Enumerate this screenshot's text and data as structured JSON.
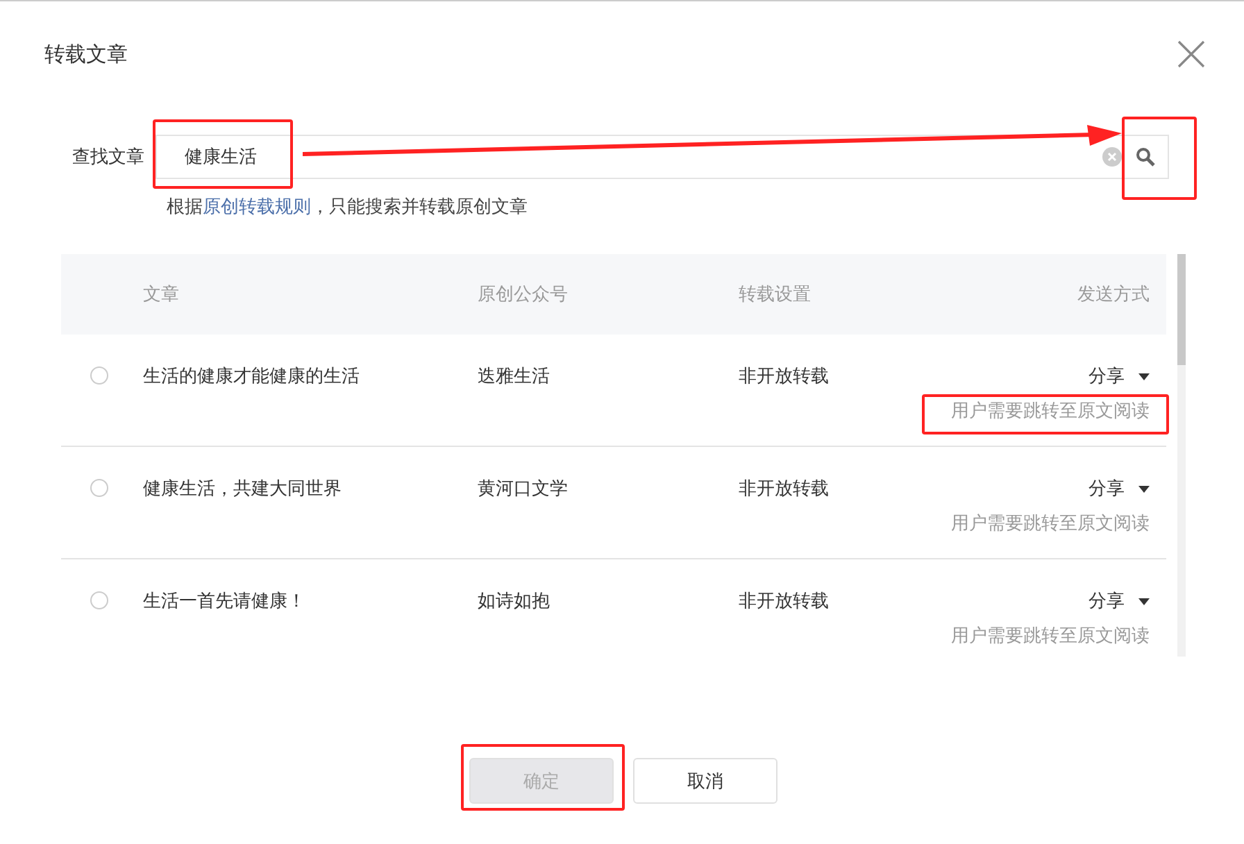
{
  "dialog": {
    "title": "转载文章"
  },
  "search": {
    "label": "查找文章",
    "value": "健康生活",
    "hint_before": "根据",
    "hint_link": "原创转载规则",
    "hint_after": "，只能搜索并转载原创文章"
  },
  "table": {
    "columns": [
      "文章",
      "原创公众号",
      "转载设置",
      "发送方式"
    ],
    "rows": [
      {
        "selected": false,
        "title": "生活的健康才能健康的生活",
        "account": "迭雅生活",
        "setting": "非开放转载",
        "send": "分享",
        "send_note": "用户需要跳转至原文阅读"
      },
      {
        "selected": false,
        "title": "健康生活，共建大同世界",
        "account": "黄河口文学",
        "setting": "非开放转载",
        "send": "分享",
        "send_note": "用户需要跳转至原文阅读"
      },
      {
        "selected": false,
        "title": "生活一首先请健康！",
        "account": "如诗如抱",
        "setting": "非开放转载",
        "send": "分享",
        "send_note": "用户需要跳转至原文阅读"
      }
    ]
  },
  "buttons": [
    {
      "label": "确定",
      "disabled": true
    },
    {
      "label": "取消",
      "disabled": false
    }
  ]
}
